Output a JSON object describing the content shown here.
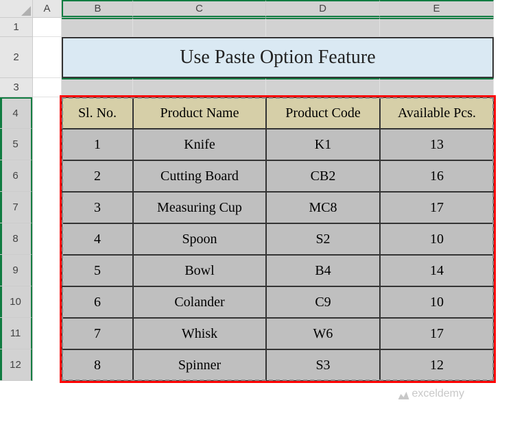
{
  "columns": [
    "A",
    "B",
    "C",
    "D",
    "E"
  ],
  "rows": [
    "1",
    "2",
    "3",
    "4",
    "5",
    "6",
    "7",
    "8",
    "9",
    "10",
    "11",
    "12"
  ],
  "title": "Use Paste Option Feature",
  "headers": {
    "slno": "Sl. No.",
    "name": "Product Name",
    "code": "Product Code",
    "pcs": "Available Pcs."
  },
  "chart_data": {
    "type": "table",
    "title": "Use Paste Option Feature",
    "columns": [
      "Sl. No.",
      "Product Name",
      "Product Code",
      "Available Pcs."
    ],
    "rows": [
      {
        "slno": "1",
        "name": "Knife",
        "code": "K1",
        "pcs": "13"
      },
      {
        "slno": "2",
        "name": "Cutting Board",
        "code": "CB2",
        "pcs": "16"
      },
      {
        "slno": "3",
        "name": "Measuring Cup",
        "code": "MC8",
        "pcs": "17"
      },
      {
        "slno": "4",
        "name": "Spoon",
        "code": "S2",
        "pcs": "10"
      },
      {
        "slno": "5",
        "name": "Bowl",
        "code": "B4",
        "pcs": "14"
      },
      {
        "slno": "6",
        "name": "Colander",
        "code": "C9",
        "pcs": "10"
      },
      {
        "slno": "7",
        "name": "Whisk",
        "code": "W6",
        "pcs": "17"
      },
      {
        "slno": "8",
        "name": "Spinner",
        "code": "S3",
        "pcs": "12"
      }
    ]
  },
  "watermark": "exceldemy"
}
